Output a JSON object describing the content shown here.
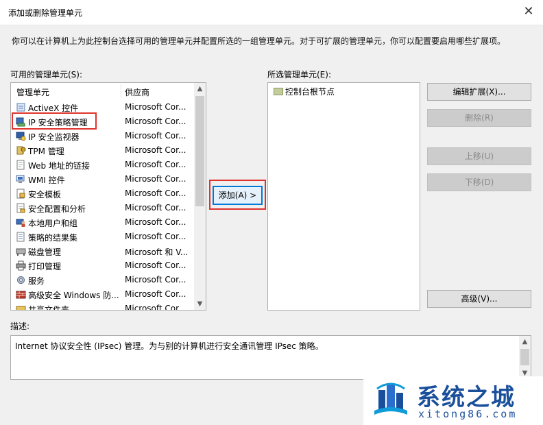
{
  "window": {
    "title": "添加或删除管理单元",
    "close_glyph": "✕"
  },
  "description": "你可以在计算机上为此控制台选择可用的管理单元并配置所选的一组管理单元。对于可扩展的管理单元，你可以配置要启用哪些扩展项。",
  "available": {
    "label": "可用的管理单元(S):",
    "columns": [
      "管理单元",
      "供应商"
    ],
    "items": [
      {
        "name": "ActiveX 控件",
        "vendor": "Microsoft Cor...",
        "icon": "activex-icon"
      },
      {
        "name": "IP 安全策略管理",
        "vendor": "Microsoft Cor...",
        "icon": "ip-security-policy-icon",
        "highlighted": true
      },
      {
        "name": "IP 安全监视器",
        "vendor": "Microsoft Cor...",
        "icon": "ip-security-monitor-icon"
      },
      {
        "name": "TPM 管理",
        "vendor": "Microsoft Cor...",
        "icon": "tpm-icon"
      },
      {
        "name": "Web 地址的链接",
        "vendor": "Microsoft Cor...",
        "icon": "web-link-icon"
      },
      {
        "name": "WMI 控件",
        "vendor": "Microsoft Cor...",
        "icon": "wmi-icon"
      },
      {
        "name": "安全模板",
        "vendor": "Microsoft Cor...",
        "icon": "security-template-icon"
      },
      {
        "name": "安全配置和分析",
        "vendor": "Microsoft Cor...",
        "icon": "security-config-icon"
      },
      {
        "name": "本地用户和组",
        "vendor": "Microsoft Cor...",
        "icon": "users-groups-icon"
      },
      {
        "name": "策略的结果集",
        "vendor": "Microsoft Cor...",
        "icon": "rsop-icon"
      },
      {
        "name": "磁盘管理",
        "vendor": "Microsoft 和 V...",
        "icon": "disk-icon"
      },
      {
        "name": "打印管理",
        "vendor": "Microsoft Cor...",
        "icon": "printer-icon"
      },
      {
        "name": "服务",
        "vendor": "Microsoft Cor...",
        "icon": "services-gear-icon"
      },
      {
        "name": "高级安全 Windows 防...",
        "vendor": "Microsoft Cor...",
        "icon": "firewall-icon"
      },
      {
        "name": "共享文件夹",
        "vendor": "Microsoft Cor...",
        "icon": "shared-folder-icon"
      }
    ]
  },
  "add_button": "添加(A) >",
  "selected": {
    "label": "所选管理单元(E):",
    "items": [
      {
        "name": "控制台根节点",
        "icon": "folder-icon"
      }
    ]
  },
  "buttons": {
    "edit_ext": "编辑扩展(X)...",
    "delete": "删除(R)",
    "move_up": "上移(U)",
    "move_down": "下移(D)",
    "advanced": "高级(V)..."
  },
  "detail": {
    "label": "描述:",
    "text": "Internet 协议安全性 (IPsec) 管理。为与别的计算机进行安全通讯管理 IPsec 策略。"
  },
  "watermark": {
    "brand": "系统之城",
    "domain": "xitong86.com"
  }
}
